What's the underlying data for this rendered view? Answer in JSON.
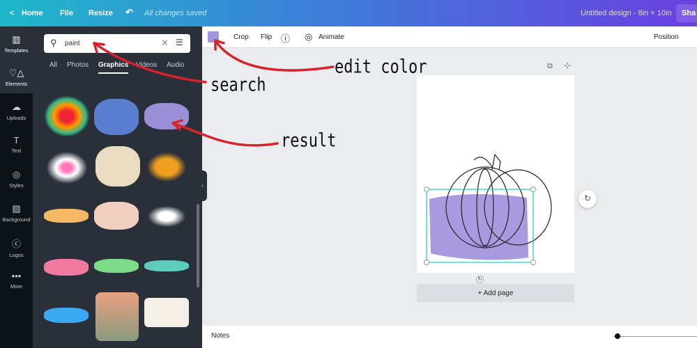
{
  "topbar": {
    "home": "Home",
    "file": "File",
    "resize": "Resize",
    "status": "All changes saved",
    "title": "Untitled design - 8in × 10in",
    "share": "Sha"
  },
  "sidebar": {
    "items": [
      {
        "label": "Templates",
        "icon": "templates-icon"
      },
      {
        "label": "Elements",
        "icon": "elements-icon"
      },
      {
        "label": "Uploads",
        "icon": "upload-icon"
      },
      {
        "label": "Text",
        "icon": "text-icon"
      },
      {
        "label": "Styles",
        "icon": "styles-icon"
      },
      {
        "label": "Background",
        "icon": "background-icon"
      },
      {
        "label": "Logos",
        "icon": "logos-icon"
      },
      {
        "label": "More",
        "icon": "more-icon"
      }
    ]
  },
  "panel": {
    "search_value": "paint",
    "tabs": [
      "All",
      "Photos",
      "Graphics",
      "Videos",
      "Audio"
    ],
    "active_tab": "Graphics"
  },
  "toolbar": {
    "color": "#a294de",
    "crop": "Crop",
    "flip": "Flip",
    "animate": "Animate",
    "position": "Position"
  },
  "canvas": {
    "add_page": "+ Add page"
  },
  "notes": {
    "label": "Notes"
  },
  "annotations": {
    "search": "search",
    "edit_color": "edit color",
    "result": "result"
  }
}
